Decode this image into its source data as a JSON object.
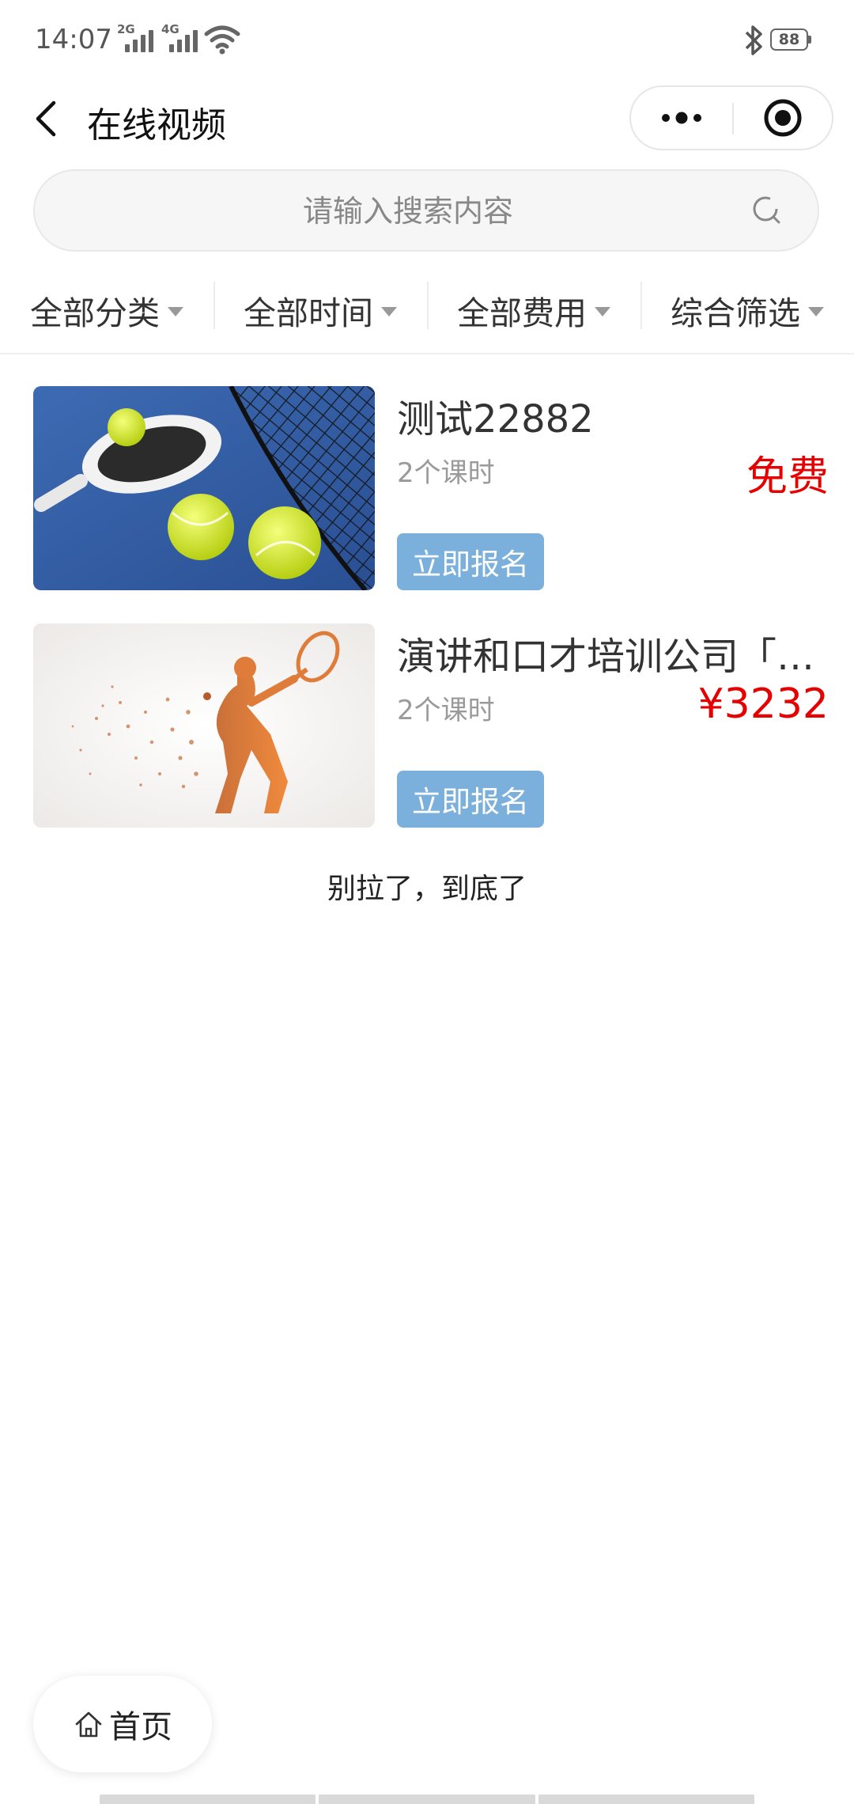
{
  "status": {
    "time": "14:07",
    "signal1_gen": "2G",
    "signal2_gen": "4G",
    "battery": "88"
  },
  "nav": {
    "title": "在线视频"
  },
  "search": {
    "placeholder": "请输入搜索内容",
    "value": ""
  },
  "filters": [
    {
      "label": "全部分类"
    },
    {
      "label": "全部时间"
    },
    {
      "label": "全部费用"
    },
    {
      "label": "综合筛选"
    }
  ],
  "courses": [
    {
      "title": "测试22882",
      "lessons": "2个课时",
      "price": "免费",
      "enroll_label": "立即报名",
      "thumbnail": "tennis-balls-racket-net"
    },
    {
      "title": "演讲和口才培训公司「…",
      "lessons": "2个课时",
      "price": "¥3232",
      "enroll_label": "立即报名",
      "thumbnail": "tennis-player-particles"
    }
  ],
  "end_text": "别拉了，到底了",
  "home": {
    "label": "首页"
  },
  "colors": {
    "price": "#e60000",
    "enroll_button": "#7ab0db"
  }
}
